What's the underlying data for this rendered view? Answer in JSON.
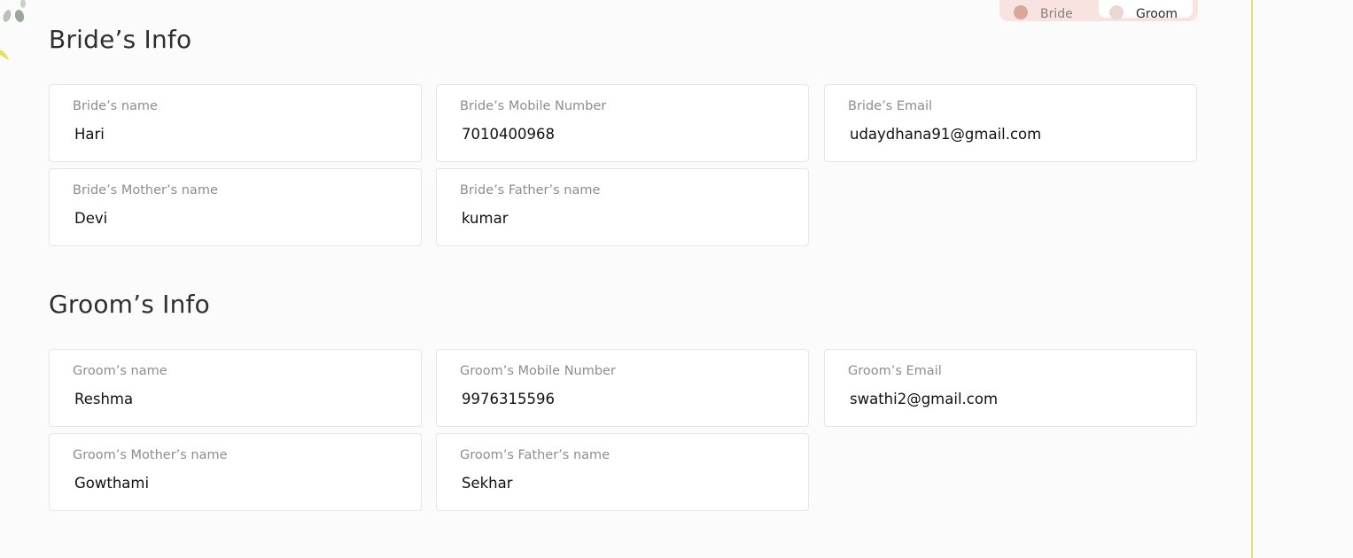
{
  "toggle": {
    "bride_label": "Bride",
    "groom_label": "Groom",
    "selected": "Groom"
  },
  "bride_section": {
    "title": "Bride’s Info",
    "fields": [
      {
        "label": "Bride’s name",
        "value": "Hari"
      },
      {
        "label": "Bride’s Mobile Number",
        "value": "7010400968"
      },
      {
        "label": "Bride’s Email",
        "value": "udaydhana91@gmail.com"
      },
      {
        "label": "Bride’s Mother’s name",
        "value": "Devi"
      },
      {
        "label": "Bride’s Father’s name",
        "value": "kumar"
      }
    ]
  },
  "groom_section": {
    "title": "Groom’s Info",
    "fields": [
      {
        "label": "Groom’s name",
        "value": "Reshma"
      },
      {
        "label": "Groom’s Mobile Number",
        "value": "9976315596"
      },
      {
        "label": "Groom’s Email",
        "value": "swathi2@gmail.com"
      },
      {
        "label": "Groom’s Mother’s name",
        "value": "Gowthami"
      },
      {
        "label": "Groom’s Father’s name",
        "value": "Sekhar"
      }
    ]
  },
  "colors": {
    "background": "#fbfbfb",
    "toggle_bg": "#f9e3e1",
    "accent_line": "#e6de7d",
    "label": "#8d8d8d",
    "value": "#111111"
  }
}
